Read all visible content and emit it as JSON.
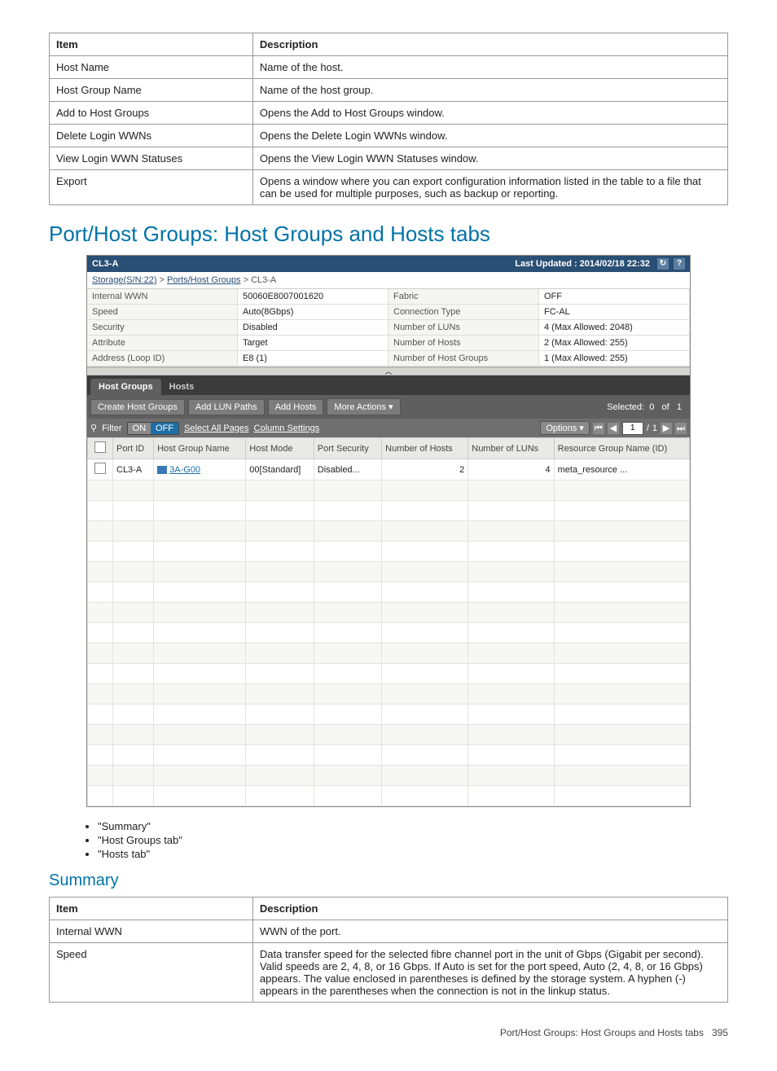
{
  "table1": {
    "headers": [
      "Item",
      "Description"
    ],
    "rows": [
      [
        "Host Name",
        "Name of the host."
      ],
      [
        "Host Group Name",
        "Name of the host group."
      ],
      [
        "Add to Host Groups",
        "Opens the Add to Host Groups window."
      ],
      [
        "Delete Login WWNs",
        "Opens the Delete Login WWNs window."
      ],
      [
        "View Login WWN Statuses",
        "Opens the View Login WWN Statuses window."
      ],
      [
        "Export",
        "Opens a window where you can export configuration information listed in the table to a file that can be used for multiple purposes, such as backup or reporting."
      ]
    ]
  },
  "heading1": "Port/Host Groups: Host Groups and Hosts tabs",
  "app": {
    "title": "CL3-A",
    "last_updated": "Last Updated : 2014/02/18 22:32",
    "breadcrumb": {
      "parts": [
        "Storage(S/N:22)",
        "Ports/Host Groups",
        "CL3-A"
      ]
    },
    "info": [
      {
        "label": "Internal WWN",
        "value": "50060E8007001620",
        "label2": "Fabric",
        "value2": "OFF"
      },
      {
        "label": "Speed",
        "value": "Auto(8Gbps)",
        "label2": "Connection Type",
        "value2": "FC-AL"
      },
      {
        "label": "Security",
        "value": "Disabled",
        "label2": "Number of LUNs",
        "value2": "4 (Max Allowed: 2048)"
      },
      {
        "label": "Attribute",
        "value": "Target",
        "label2": "Number of Hosts",
        "value2": "2 (Max Allowed: 255)"
      },
      {
        "label": "Address (Loop ID)",
        "value": "E8 (1)",
        "label2": "Number of Host Groups",
        "value2": "1 (Max Allowed: 255)"
      }
    ],
    "tabs": {
      "active": "Host Groups",
      "inactive": "Hosts"
    },
    "toolbar": {
      "create": "Create Host Groups",
      "addlun": "Add LUN Paths",
      "addhosts": "Add Hosts",
      "more": "More Actions",
      "selected_label": "Selected:",
      "selected_count": "0",
      "selected_of": "of",
      "selected_total": "1"
    },
    "filterbar": {
      "filter_label": "Filter",
      "on": "ON",
      "off": "OFF",
      "select_all": "Select All Pages",
      "col_settings": "Column Settings",
      "options": "Options",
      "page_current": "1",
      "page_total": "1"
    },
    "columns": [
      "",
      "Port ID",
      "Host Group Name",
      "Host Mode",
      "Port Security",
      "Number of Hosts",
      "Number of LUNs",
      "Resource Group Name (ID)"
    ],
    "row": {
      "port_id": "CL3-A",
      "hg_name": "3A-G00",
      "host_mode": "00[Standard]",
      "port_sec": "Disabled...",
      "num_hosts": "2",
      "num_luns": "4",
      "res_group": "meta_resource ..."
    }
  },
  "bullets": [
    "\"Summary\"",
    "\"Host Groups tab\"",
    "\"Hosts tab\""
  ],
  "heading2": "Summary",
  "table2": {
    "headers": [
      "Item",
      "Description"
    ],
    "rows": [
      [
        "Internal WWN",
        "WWN of the port."
      ],
      [
        "Speed",
        "Data transfer speed for the selected fibre channel port in the unit of Gbps (Gigabit per second). Valid speeds are 2, 4, 8, or 16 Gbps. If Auto is set for the port speed, Auto (2, 4, 8, or 16 Gbps) appears. The value enclosed in parentheses is defined by the storage system. A hyphen (-) appears in the parentheses when the connection is not in the linkup status."
      ]
    ]
  },
  "footer": {
    "text": "Port/Host Groups: Host Groups and Hosts tabs",
    "page": "395"
  }
}
